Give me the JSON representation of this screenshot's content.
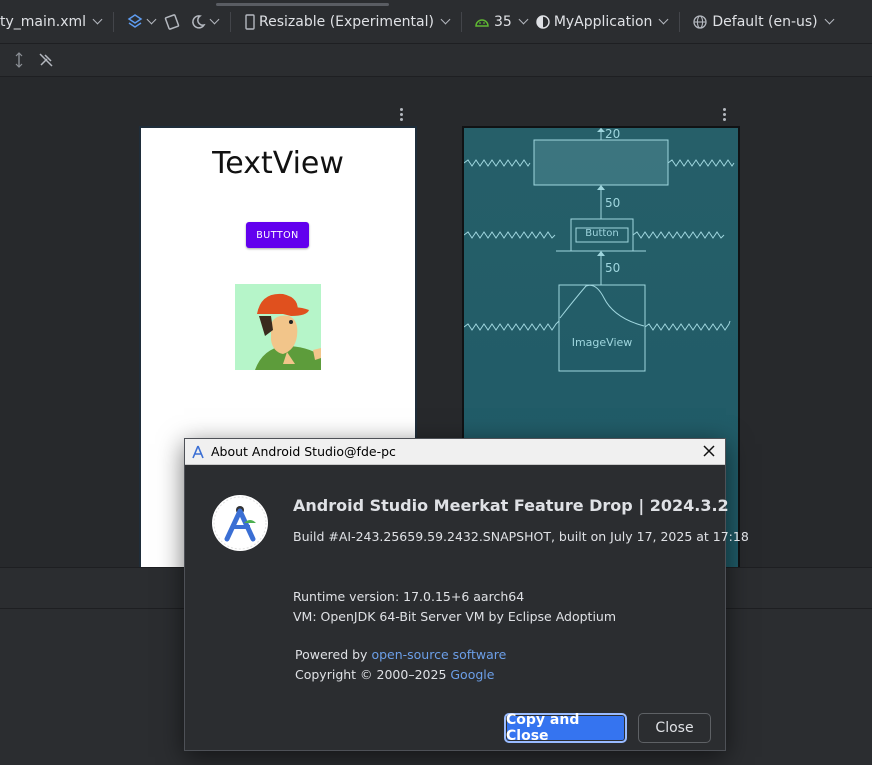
{
  "toolbar": {
    "file_name": "ty_main.xml",
    "device": "Resizable (Experimental)",
    "api_level": "35",
    "theme": "MyApplication",
    "locale": "Default (en-us)"
  },
  "preview": {
    "text_view": "TextView",
    "button": "BUTTON"
  },
  "blueprint": {
    "margin_top": "20",
    "margin_mid": "50",
    "margin_low": "50",
    "button_label": "Button",
    "image_label": "ImageView"
  },
  "dialog": {
    "title": "About Android Studio@fde-pc",
    "product_name": "Android Studio Meerkat Feature Drop | 2024.3.2",
    "build": "Build #AI-243.25659.59.2432.SNAPSHOT, built on July 17, 2025 at 17:18",
    "runtime": "Runtime version: 17.0.15+6 aarch64",
    "vm": "VM: OpenJDK 64-Bit Server VM by Eclipse Adoptium",
    "powered_by": "Powered by ",
    "powered_link": "open-source software",
    "copyright": "Copyright © 2000–2025 ",
    "copyright_link": "Google",
    "copy_close_button": "Copy and Close",
    "close_button": "Close"
  },
  "colors": {
    "accent": "#3574f0",
    "link": "#6c9fe8",
    "preview_button": "#6200ee",
    "blueprint": "#225e69"
  }
}
